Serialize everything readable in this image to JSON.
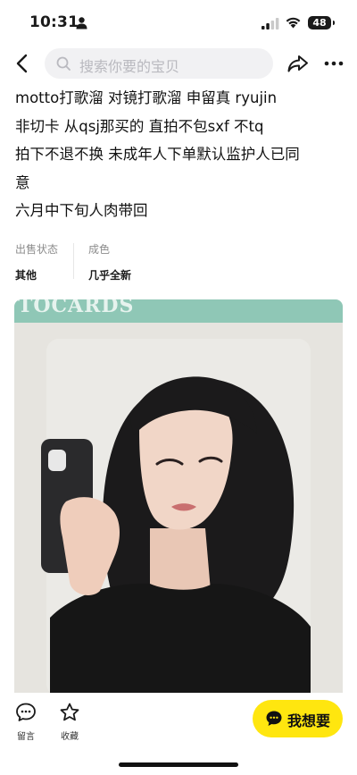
{
  "status_bar": {
    "time": "10:31",
    "battery": "48"
  },
  "search": {
    "placeholder": "搜索你要的宝贝"
  },
  "description": {
    "lines": [
      "motto打歌溜 对镜打歌溜 申留真 ryujin",
      "非切卡 从qsj那买的  直拍不包sxf 不tq",
      "拍下不退不换 未成年人下单默认监护人已同",
      "意",
      "六月中下旬人肉带回"
    ]
  },
  "attributes": [
    {
      "label": "出售状态",
      "value": "其他"
    },
    {
      "label": "成色",
      "value": "几乎全新"
    }
  ],
  "photo": {
    "banner_text": "TOCARDS"
  },
  "bottom_bar": {
    "comment_label": "留言",
    "favorite_label": "收藏",
    "want_label": "我想要"
  },
  "colors": {
    "accent": "#ffe60f",
    "banner": "#8fc7b6"
  },
  "icons": [
    "person-icon",
    "signal-icon",
    "wifi-icon",
    "battery-icon",
    "back-icon",
    "search-icon",
    "share-icon",
    "more-icon",
    "comment-icon",
    "star-icon",
    "chat-icon"
  ]
}
